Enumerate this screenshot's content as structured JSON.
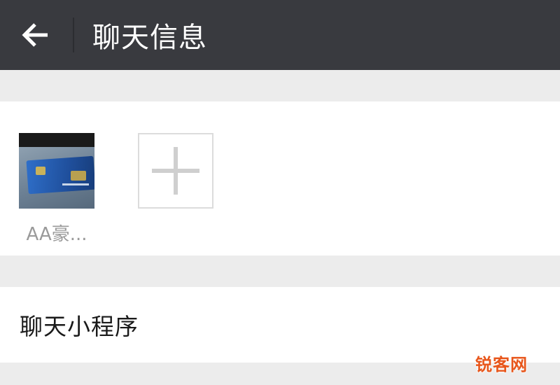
{
  "header": {
    "back_icon": "arrow-left-icon",
    "title": "聊天信息",
    "background": "#393a3f"
  },
  "members": {
    "items": [
      {
        "name": "AA豪...",
        "avatar": "photo-of-bank-card"
      }
    ],
    "add_icon": "plus-icon"
  },
  "rows": {
    "mini_program_label": "聊天小程序"
  },
  "watermark": {
    "text": "锐客网",
    "color": "#e8561b"
  }
}
